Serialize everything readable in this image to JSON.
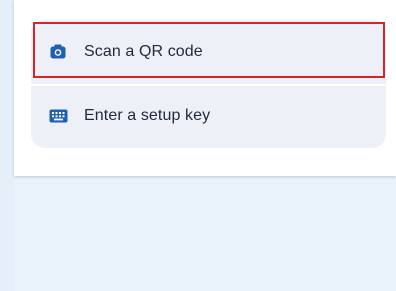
{
  "menu": {
    "options": [
      {
        "label": "Scan a QR code",
        "icon": "camera-icon"
      },
      {
        "label": "Enter a setup key",
        "icon": "keyboard-icon"
      }
    ]
  },
  "colors": {
    "icon_blue": "#1e5fb3",
    "highlight_red": "#d9232a",
    "background": "#e9f1fb"
  }
}
